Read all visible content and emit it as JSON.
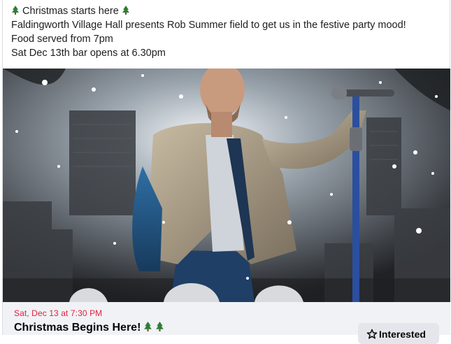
{
  "post": {
    "line1": "Christmas starts here",
    "line2": "Faldingworth Village Hall presents Rob Summer field to get us in the festive party mood!",
    "line3": "Food served from 7pm",
    "line4": "Sat Dec 13th bar opens at 6.30pm"
  },
  "event": {
    "date": "Sat, Dec 13 at 7:30 PM",
    "title": "Christmas Begins Here!",
    "interested_label": "Interested"
  },
  "colors": {
    "date_red": "#e41e3f",
    "tree_green": "#2e7d32",
    "button_bg": "#e4e6eb",
    "event_bar_bg": "#f0f2f5"
  },
  "icons": [
    "christmas-tree-icon",
    "star-outline-icon"
  ]
}
